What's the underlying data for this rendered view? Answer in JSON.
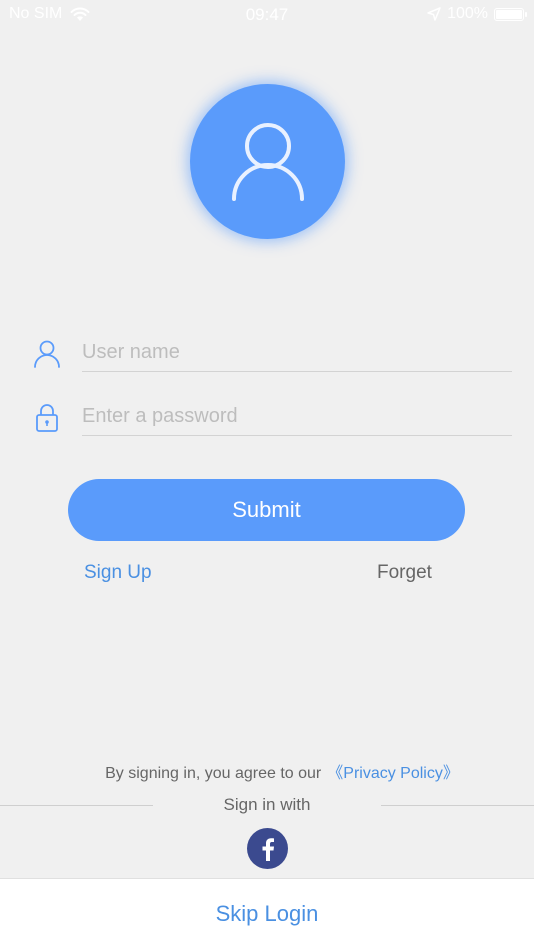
{
  "status_bar": {
    "carrier": "No SIM",
    "time": "09:47",
    "battery": "100%",
    "icons": [
      "wifi-icon",
      "location-arrow-icon",
      "battery-icon"
    ]
  },
  "avatar": {
    "icon": "user-icon",
    "color": "#5a9bfb"
  },
  "form": {
    "username": {
      "icon": "user-outline-icon",
      "value": "",
      "placeholder": "User name"
    },
    "password": {
      "icon": "lock-icon",
      "value": "",
      "placeholder": "Enter a password"
    },
    "submit_label": "Submit",
    "sign_up_label": "Sign Up",
    "forget_label": "Forget"
  },
  "footer": {
    "agree_text": "By signing in, you agree to our",
    "privacy_link": "《Privacy Policy》",
    "sign_in_with": "Sign in with",
    "social": [
      "facebook-icon"
    ],
    "skip_login": "Skip Login"
  },
  "colors": {
    "accent": "#5a9bfb",
    "link": "#4a90e2",
    "facebook": "#3b4a8f",
    "background": "#f0f0f0"
  }
}
